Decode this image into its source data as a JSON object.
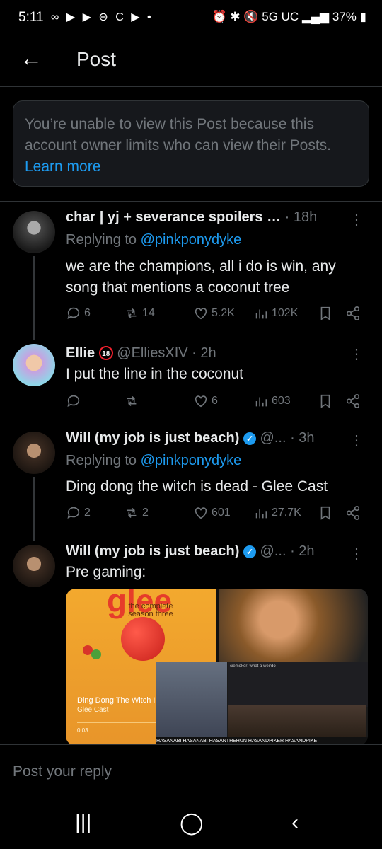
{
  "status": {
    "time": "5:11",
    "network": "5G UC",
    "battery": "37%"
  },
  "header": {
    "title": "Post"
  },
  "notice": {
    "text": "You’re unable to view this Post because this account owner limits who can view their Posts.",
    "link": "Learn more"
  },
  "posts": [
    {
      "name": "char | yj + severance spoilers …",
      "time": "· 18h",
      "replying_label": "Replying to ",
      "replying_to": "@pinkponydyke",
      "text": "we are the champions, all i do is win, any song that mentions a coconut tree",
      "replies": "6",
      "reposts": "14",
      "likes": "5.2K",
      "views": "102K"
    },
    {
      "name": "Ellie",
      "handle": "@ElliesXIV · 2h",
      "text": "I put the line in the coconut",
      "replies": "",
      "reposts": "",
      "likes": "6",
      "views": "603"
    },
    {
      "name": "Will (my job is just beach)",
      "handle": "@...",
      "time": "· 3h",
      "replying_label": "Replying to ",
      "replying_to": "@pinkponydyke",
      "text": "Ding dong the witch is dead - Glee Cast",
      "replies": "2",
      "reposts": "2",
      "likes": "601",
      "views": "27.7K"
    },
    {
      "name": "Will (my job is just beach)",
      "handle": "@...",
      "time": "· 2h",
      "text": "Pre gaming:"
    }
  ],
  "media": {
    "album_title": "glee",
    "album_subtitle": "the complete season three",
    "track": "Ding Dong The Witch I",
    "artist": "Glee Cast",
    "elapsed": "0:03",
    "chat_line": "ciemoker: what a weirdo",
    "stream_bar": "HASANABI  HASANABI  HASANTHEHUN  HASANDPIKER  HASANDPIKE"
  },
  "reply_bar": {
    "placeholder": "Post your reply"
  },
  "colors": {
    "accent": "#1d9bf0",
    "muted": "#71767b",
    "background": "#000000"
  }
}
